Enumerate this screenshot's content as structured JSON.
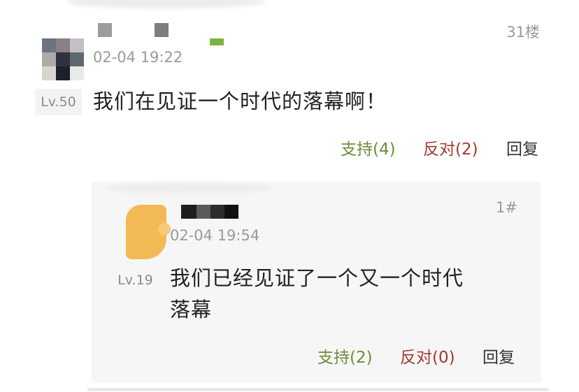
{
  "comment": {
    "floor": "31楼",
    "time": "02-04 19:22",
    "level": "Lv.50",
    "content": "我们在见证一个时代的落幕啊！",
    "actions": {
      "support": "支持(4)",
      "oppose": "反对(2)",
      "reply": "回复"
    }
  },
  "reply_comment": {
    "floor": "1#",
    "time": "02-04 19:54",
    "level": "Lv.19",
    "content_line1": "我们已经见证了一个又一个时代",
    "content_line2": "落幕",
    "actions": {
      "support": "支持(2)",
      "oppose": "反对(0)",
      "reply": "回复"
    }
  },
  "colors": {
    "support": "#6e8c3a",
    "oppose": "#a23a2e",
    "meta_gray": "#9a9a9a",
    "avatar_orange": "#f3b955"
  },
  "icons": {
    "main_avatar": "pixelated-avatar",
    "reply_avatar": "orange-avatar"
  }
}
